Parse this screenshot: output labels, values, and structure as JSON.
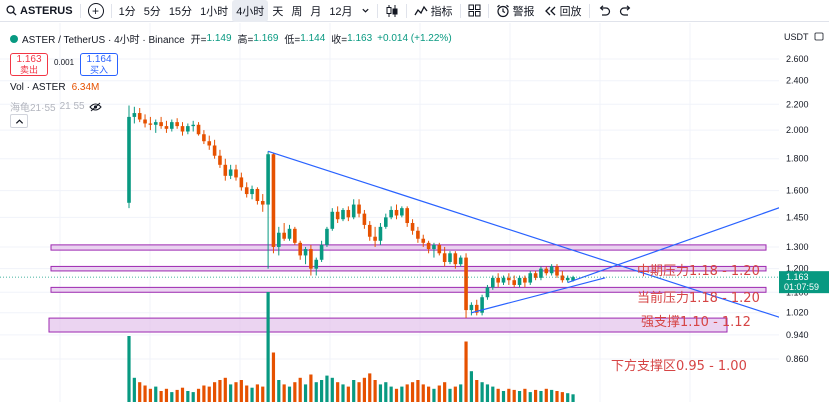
{
  "toolbar": {
    "symbol": "ASTERUS",
    "intervals": [
      "1分",
      "5分",
      "15分",
      "1小时",
      "4小时",
      "天",
      "周",
      "月",
      "12月"
    ],
    "active_interval": "4小时",
    "indicators_label": "指标",
    "alert_label": "警报",
    "replay_label": "回放",
    "icons": [
      "search-icon",
      "plus-icon",
      "chevron-down-icon",
      "candles-icon",
      "indicators-icon",
      "layout-icon",
      "alarm-clock-icon",
      "replay-icon",
      "undo-icon",
      "redo-icon"
    ]
  },
  "legend": {
    "title": "ASTER / TetherUS · 4小时 · Binance",
    "open_key": "开=",
    "open": "1.149",
    "high_key": "高=",
    "high": "1.169",
    "low_key": "低=",
    "low": "1.144",
    "close_key": "收=",
    "close": "1.163",
    "change": "+0.014 (+1.22%)",
    "sell_price": "1.163",
    "sell_label": "卖出",
    "spread": "0.001",
    "buy_price": "1.164",
    "buy_label": "买入",
    "volume_label": "Vol · ASTER",
    "volume_value": "6.34M",
    "turtle_label": "海龟21·55",
    "turtle_params": "21 55"
  },
  "colors": {
    "up": "#089981",
    "down": "#e65100",
    "channel_line": "#2962ff",
    "zone_fill": "#e4c6ec",
    "zone_border": "#9c27b0",
    "annotation": "#d64545",
    "price_label_bg": "#089981"
  },
  "chart_data": {
    "type": "candlestick",
    "price_scale": "log",
    "currency": "USDT",
    "y_ticks": [
      2.6,
      2.4,
      2.2,
      2.0,
      1.8,
      1.6,
      1.45,
      1.3,
      1.2,
      1.1,
      1.02,
      0.94,
      0.86
    ],
    "y_tick_labels": [
      "2.600",
      "2.400",
      "2.200",
      "2.000",
      "1.800",
      "1.600",
      "1.450",
      "1.300",
      "1.200",
      "1.100",
      "1.020",
      "0.940",
      "0.860"
    ],
    "last_price": "1.163",
    "countdown": "01:07:59",
    "candles": [
      [
        1.53,
        2.19,
        1.5,
        2.1
      ],
      [
        2.1,
        2.18,
        2.05,
        2.13
      ],
      [
        2.13,
        2.17,
        2.06,
        2.08
      ],
      [
        2.08,
        2.12,
        2.02,
        2.05
      ],
      [
        2.05,
        2.1,
        2.0,
        2.04
      ],
      [
        2.04,
        2.08,
        1.98,
        2.06
      ],
      [
        2.06,
        2.1,
        2.01,
        2.03
      ],
      [
        2.03,
        2.07,
        1.98,
        2.01
      ],
      [
        2.01,
        2.08,
        1.99,
        2.06
      ],
      [
        2.06,
        2.09,
        2.01,
        2.03
      ],
      [
        2.03,
        2.06,
        1.96,
        1.99
      ],
      [
        1.99,
        2.05,
        1.97,
        2.03
      ],
      [
        2.03,
        2.07,
        1.99,
        2.04
      ],
      [
        2.04,
        2.06,
        1.96,
        1.97
      ],
      [
        1.97,
        2.0,
        1.9,
        1.92
      ],
      [
        1.92,
        1.96,
        1.86,
        1.89
      ],
      [
        1.89,
        1.93,
        1.8,
        1.82
      ],
      [
        1.82,
        1.86,
        1.74,
        1.76
      ],
      [
        1.76,
        1.8,
        1.66,
        1.69
      ],
      [
        1.69,
        1.76,
        1.67,
        1.73
      ],
      [
        1.73,
        1.76,
        1.66,
        1.68
      ],
      [
        1.68,
        1.71,
        1.6,
        1.62
      ],
      [
        1.62,
        1.65,
        1.56,
        1.58
      ],
      [
        1.58,
        1.63,
        1.55,
        1.61
      ],
      [
        1.61,
        1.62,
        1.52,
        1.54
      ],
      [
        1.54,
        1.58,
        1.48,
        1.52
      ],
      [
        1.52,
        1.85,
        1.2,
        1.83
      ],
      [
        1.83,
        1.84,
        1.27,
        1.3
      ],
      [
        1.3,
        1.4,
        1.26,
        1.37
      ],
      [
        1.37,
        1.42,
        1.33,
        1.34
      ],
      [
        1.34,
        1.41,
        1.33,
        1.39
      ],
      [
        1.39,
        1.4,
        1.31,
        1.32
      ],
      [
        1.32,
        1.33,
        1.24,
        1.26
      ],
      [
        1.26,
        1.3,
        1.22,
        1.29
      ],
      [
        1.29,
        1.31,
        1.17,
        1.2
      ],
      [
        1.2,
        1.25,
        1.17,
        1.24
      ],
      [
        1.24,
        1.33,
        1.23,
        1.31
      ],
      [
        1.31,
        1.4,
        1.3,
        1.39
      ],
      [
        1.39,
        1.5,
        1.38,
        1.48
      ],
      [
        1.48,
        1.51,
        1.42,
        1.44
      ],
      [
        1.44,
        1.5,
        1.43,
        1.49
      ],
      [
        1.49,
        1.51,
        1.43,
        1.45
      ],
      [
        1.45,
        1.55,
        1.44,
        1.52
      ],
      [
        1.52,
        1.55,
        1.45,
        1.47
      ],
      [
        1.47,
        1.49,
        1.39,
        1.41
      ],
      [
        1.41,
        1.43,
        1.33,
        1.35
      ],
      [
        1.35,
        1.4,
        1.3,
        1.33
      ],
      [
        1.33,
        1.42,
        1.31,
        1.4
      ],
      [
        1.4,
        1.47,
        1.39,
        1.45
      ],
      [
        1.45,
        1.51,
        1.44,
        1.49
      ],
      [
        1.49,
        1.52,
        1.44,
        1.46
      ],
      [
        1.46,
        1.51,
        1.45,
        1.5
      ],
      [
        1.5,
        1.51,
        1.4,
        1.42
      ],
      [
        1.42,
        1.44,
        1.36,
        1.38
      ],
      [
        1.38,
        1.4,
        1.32,
        1.34
      ],
      [
        1.34,
        1.36,
        1.3,
        1.32
      ],
      [
        1.32,
        1.33,
        1.27,
        1.29
      ],
      [
        1.29,
        1.32,
        1.25,
        1.31
      ],
      [
        1.31,
        1.32,
        1.26,
        1.27
      ],
      [
        1.27,
        1.3,
        1.21,
        1.23
      ],
      [
        1.23,
        1.28,
        1.22,
        1.27
      ],
      [
        1.27,
        1.28,
        1.2,
        1.22
      ],
      [
        1.22,
        1.26,
        1.21,
        1.25
      ],
      [
        1.25,
        1.27,
        1.0,
        1.03
      ],
      [
        1.03,
        1.06,
        1.01,
        1.05
      ],
      [
        1.05,
        1.07,
        1.01,
        1.02
      ],
      [
        1.02,
        1.09,
        1.01,
        1.08
      ],
      [
        1.08,
        1.13,
        1.07,
        1.12
      ],
      [
        1.12,
        1.17,
        1.11,
        1.16
      ],
      [
        1.16,
        1.18,
        1.12,
        1.14
      ],
      [
        1.14,
        1.17,
        1.13,
        1.16
      ],
      [
        1.16,
        1.18,
        1.13,
        1.15
      ],
      [
        1.15,
        1.17,
        1.12,
        1.13
      ],
      [
        1.13,
        1.17,
        1.12,
        1.16
      ],
      [
        1.16,
        1.17,
        1.12,
        1.14
      ],
      [
        1.14,
        1.19,
        1.13,
        1.18
      ],
      [
        1.18,
        1.19,
        1.15,
        1.16
      ],
      [
        1.16,
        1.21,
        1.15,
        1.2
      ],
      [
        1.2,
        1.21,
        1.17,
        1.18
      ],
      [
        1.18,
        1.22,
        1.17,
        1.21
      ],
      [
        1.21,
        1.22,
        1.16,
        1.17
      ],
      [
        1.17,
        1.19,
        1.14,
        1.15
      ],
      [
        1.15,
        1.17,
        1.14,
        1.16
      ],
      [
        1.149,
        1.169,
        1.144,
        1.163
      ]
    ],
    "volumes": [
      60,
      22,
      18,
      15,
      12,
      14,
      10,
      12,
      9,
      11,
      13,
      10,
      9,
      12,
      15,
      14,
      18,
      20,
      22,
      16,
      18,
      20,
      15,
      13,
      16,
      14,
      100,
      45,
      20,
      16,
      14,
      18,
      22,
      16,
      25,
      18,
      20,
      24,
      22,
      18,
      16,
      14,
      20,
      18,
      22,
      26,
      20,
      16,
      18,
      14,
      12,
      14,
      16,
      18,
      20,
      16,
      14,
      12,
      15,
      18,
      12,
      14,
      16,
      55,
      28,
      20,
      18,
      16,
      14,
      12,
      10,
      12,
      11,
      10,
      12,
      9,
      11,
      10,
      12,
      11,
      10,
      9,
      8,
      7
    ],
    "zones": [
      {
        "lo": 1.285,
        "hi": 1.31,
        "label": "中期压力1.18 - 1.20"
      },
      {
        "lo": 1.19,
        "hi": 1.21,
        "label": "当前压力1.18 - 1.20"
      },
      {
        "lo": 1.1,
        "hi": 1.12,
        "label": "强支撑1.10 - 1.12"
      },
      {
        "lo": 0.95,
        "hi": 1.0,
        "label": "下方支撑区0.95 - 1.00"
      }
    ],
    "trendlines": [
      {
        "from": [
          26,
          1.85
        ],
        "to": [
          126,
          0.975
        ]
      },
      {
        "from": [
          64,
          1.02
        ],
        "to": [
          89,
          1.16
        ]
      },
      {
        "from": [
          82,
          1.14
        ],
        "to": [
          126,
          1.55
        ]
      }
    ]
  }
}
